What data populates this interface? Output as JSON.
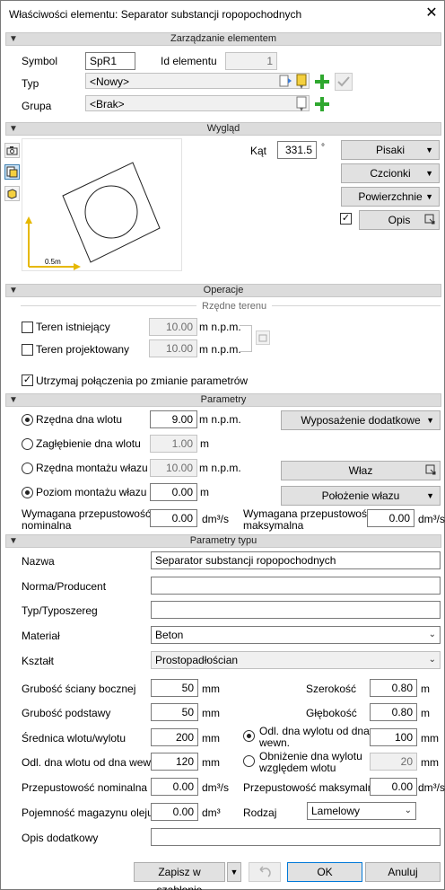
{
  "window": {
    "title": "Właściwości elementu: Separator substancji ropopochodnych",
    "close": "✕"
  },
  "sections": {
    "zarzadzanie": "Zarządzanie elementem",
    "wyglad": "Wygląd",
    "operacje": "Operacje",
    "parametry": "Parametry",
    "parametry_typu": "Parametry typu"
  },
  "element": {
    "symbol_label": "Symbol",
    "symbol_value": "SpR1",
    "id_label": "Id elementu",
    "id_value": "1",
    "typ_label": "Typ",
    "typ_value": "<Nowy>",
    "grupa_label": "Grupa",
    "grupa_value": "<Brak>"
  },
  "wyglad": {
    "kat_label": "Kąt",
    "kat_value": "331.5",
    "kat_unit": "°",
    "pisaki": "Pisaki",
    "czcionki": "Czcionki",
    "powierzchnie": "Powierzchnie",
    "opis": "Opis",
    "scale_label": "0.5m"
  },
  "operacje": {
    "rzedne_terenu": "Rzędne terenu",
    "teren_istniejacy": "Teren istniejący",
    "teren_istniejacy_value": "10.00",
    "teren_projektowany": "Teren projektowany",
    "teren_projektowany_value": "10.00",
    "unit": "m n.p.m.",
    "utrzymaj": "Utrzymaj połączenia po zmianie parametrów"
  },
  "parametry": {
    "rzedna_dna_wlotu": "Rzędna dna wlotu",
    "rzedna_dna_wlotu_value": "9.00",
    "unit_npm": "m n.p.m.",
    "zaglebienie": "Zagłębienie dna wlotu",
    "zaglebienie_value": "1.00",
    "unit_m": "m",
    "rzedna_montazu": "Rzędna montażu włazu",
    "rzedna_montazu_value": "10.00",
    "poziom_montazu": "Poziom montażu włazu",
    "poziom_montazu_value": "0.00",
    "wyposazenie": "Wyposażenie dodatkowe",
    "wlaz": "Właz",
    "polozenie": "Położenie włazu",
    "wym_nom_1": "Wymagana przepustowość",
    "wym_nom_2": "nominalna",
    "wym_nom_value": "0.00",
    "wym_max_1": "Wymagana przepustowość",
    "wym_max_2": "maksymalna",
    "wym_max_value": "0.00",
    "unit_dm3s": "dm³/s"
  },
  "typ": {
    "nazwa": "Nazwa",
    "nazwa_value": "Separator substancji ropopochodnych",
    "norma": "Norma/Producent",
    "norma_value": "",
    "typoszereg": "Typ/Typoszereg",
    "typoszereg_value": "",
    "material": "Materiał",
    "material_value": "Beton",
    "ksztalt": "Kształt",
    "ksztalt_value": "Prostopadłościan",
    "grubosc_scianki": "Grubość ściany bocznej",
    "grubosc_scianki_value": "50",
    "szerokosc": "Szerokość",
    "szerokosc_value": "0.80",
    "grubosc_podstawy": "Grubość podstawy",
    "grubosc_podstawy_value": "50",
    "glebokosc": "Głębokość",
    "glebokosc_value": "0.80",
    "srednica": "Średnica wlotu/wylotu",
    "srednica_value": "200",
    "odl_dna_wylotu_1": "Odl. dna wylotu od dna",
    "odl_dna_wylotu_2": "wewn.",
    "odl_dna_wylotu_value": "100",
    "odl_dna_wlotu": "Odl. dna wlotu od dna wewn.",
    "odl_dna_wlotu_value": "120",
    "obnizenie_1": "Obniżenie dna wylotu",
    "obnizenie_2": "względem wlotu",
    "obnizenie_value": "20",
    "przep_nom": "Przepustowość nominalna",
    "przep_nom_value": "0.00",
    "przep_max": "Przepustowość maksymalna",
    "przep_max_value": "0.00",
    "pojemnosc": "Pojemność magazynu oleju",
    "pojemnosc_value": "0.00",
    "rodzaj": "Rodzaj",
    "rodzaj_value": "Lamelowy",
    "opis_dod": "Opis dodatkowy",
    "opis_dod_value": "",
    "unit_mm": "mm",
    "unit_m": "m",
    "unit_dm3s": "dm³/s",
    "unit_dm3": "dm³"
  },
  "footer": {
    "zapisz": "Zapisz w szablonie",
    "ok": "OK",
    "anuluj": "Anuluj"
  },
  "colors": {
    "section_bg": "#dcdcdc",
    "accent_green": "#2fa82f",
    "axis_yellow": "#e6b800"
  }
}
